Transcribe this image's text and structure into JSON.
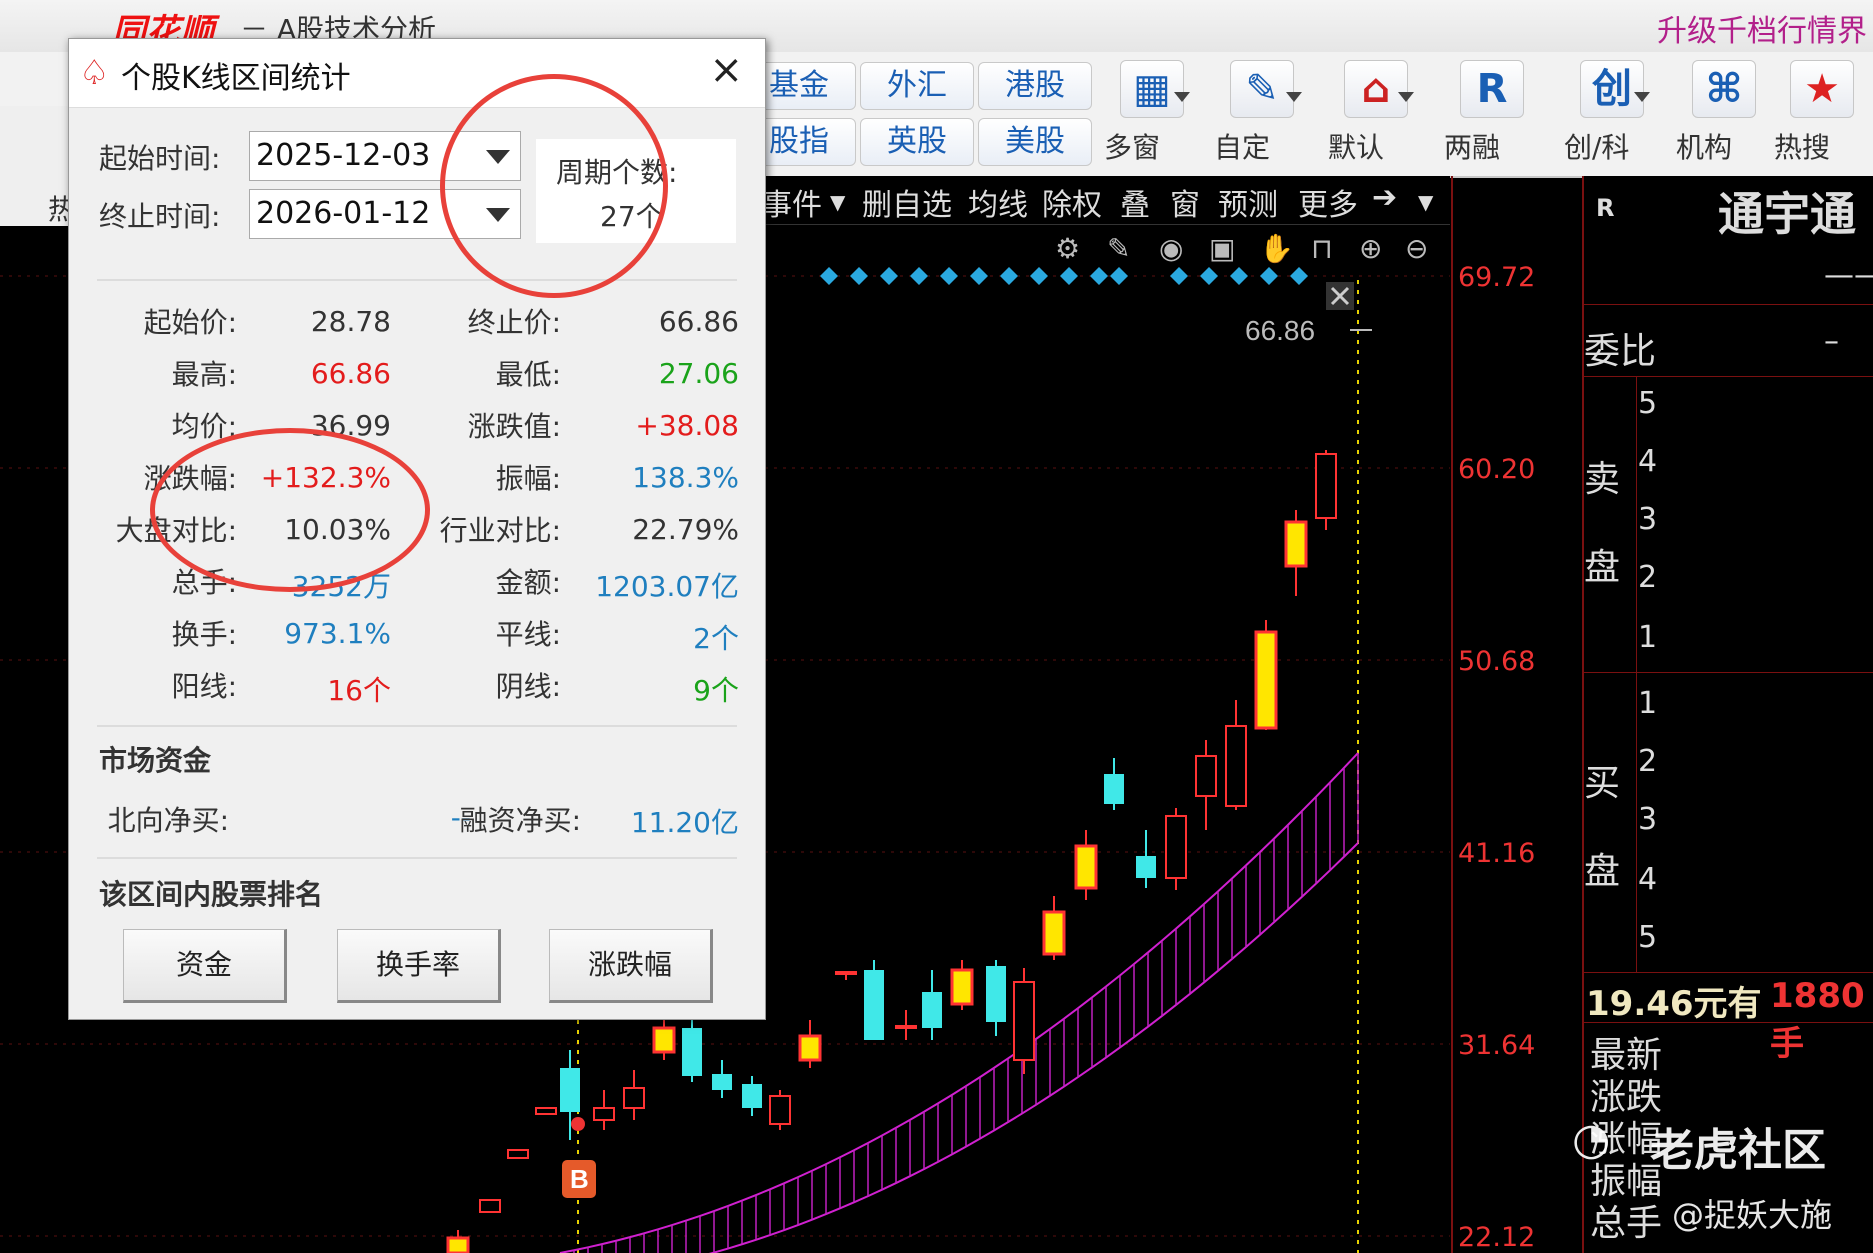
{
  "app": {
    "logo": "同花顺",
    "title": "－ A股技术分析",
    "promo": "升级千档行情界"
  },
  "toolbar": {
    "left_partial": "热",
    "small_buttons": [
      "基金",
      "外汇",
      "港股",
      "股指",
      "英股",
      "美股"
    ],
    "big_buttons": [
      {
        "label": "多窗",
        "icon": "multi-window-icon",
        "glyph": "▦"
      },
      {
        "label": "自定",
        "icon": "custom-icon",
        "glyph": "✎"
      },
      {
        "label": "默认",
        "icon": "home-icon",
        "glyph": "⌂"
      },
      {
        "label": "两融",
        "icon": "margin-icon",
        "glyph": "R"
      },
      {
        "label": "创/科",
        "icon": "chuang-icon",
        "glyph": "创"
      },
      {
        "label": "机构",
        "icon": "institution-icon",
        "glyph": "⌘"
      },
      {
        "label": "热搜",
        "icon": "hot-search-icon",
        "glyph": "★"
      }
    ]
  },
  "chart_toolbar": {
    "items": [
      "事件",
      "删自选",
      "均线",
      "除权",
      "叠",
      "窗",
      "预测",
      "更多",
      "➔"
    ]
  },
  "dialog": {
    "title": "个股K线区间统计",
    "close": "×",
    "start_label": "起始时间:",
    "start_value": "2025-12-03",
    "end_label": "终止时间:",
    "end_value": "2026-01-12",
    "period_label": "周期个数:",
    "period_value": "27个",
    "stats": {
      "start_price_k": "起始价:",
      "start_price_v": "28.78",
      "end_price_k": "终止价:",
      "end_price_v": "66.86",
      "high_k": "最高:",
      "high_v": "66.86",
      "low_k": "最低:",
      "low_v": "27.06",
      "avg_k": "均价:",
      "avg_v": "36.99",
      "chg_k": "涨跌值:",
      "chg_v": "+38.08",
      "pct_k": "涨跌幅:",
      "pct_v": "+132.3%",
      "amp_k": "振幅:",
      "amp_v": "138.3%",
      "mkt_k": "大盘对比:",
      "mkt_v": "10.03%",
      "ind_k": "行业对比:",
      "ind_v": "22.79%",
      "vol_k": "总手:",
      "vol_v": "3252万",
      "amt_k": "金额:",
      "amt_v": "1203.07亿",
      "turn_k": "换手:",
      "turn_v": "973.1%",
      "flat_k": "平线:",
      "flat_v": "2个",
      "yang_k": "阳线:",
      "yang_v": "16个",
      "yin_k": "阴线:",
      "yin_v": "9个"
    },
    "market_funds_title": "市场资金",
    "north_k": "北向净买:",
    "north_v": "--",
    "margin_k": "融资净买:",
    "margin_v": "11.20亿",
    "ranking_title": "该区间内股票排名",
    "btn_funds": "资金",
    "btn_turnover": "换手率",
    "btn_change": "涨跌幅"
  },
  "chart": {
    "price_labels": [
      "69.72",
      "60.20",
      "50.68",
      "41.16",
      "31.64",
      "22.12"
    ],
    "last_price_tag": "66.86",
    "buy_marker": "B"
  },
  "right_panel": {
    "r_mark": "R",
    "stock_name": "通宇通",
    "dash": "——",
    "weibi": "委比",
    "weibi_val": "–",
    "sell": [
      "卖",
      "盘"
    ],
    "buy": [
      "买",
      "盘"
    ],
    "sell_levels": [
      "5",
      "4",
      "3",
      "2",
      "1"
    ],
    "buy_levels": [
      "1",
      "2",
      "3",
      "4",
      "5"
    ],
    "cash_text": "19.46元有",
    "cash_hand": "1880手",
    "rows": [
      "最新",
      "涨跌",
      "涨幅",
      "振幅",
      "总手"
    ]
  },
  "watermark": {
    "main": "老虎社区",
    "sub": "@捉妖大施"
  }
}
